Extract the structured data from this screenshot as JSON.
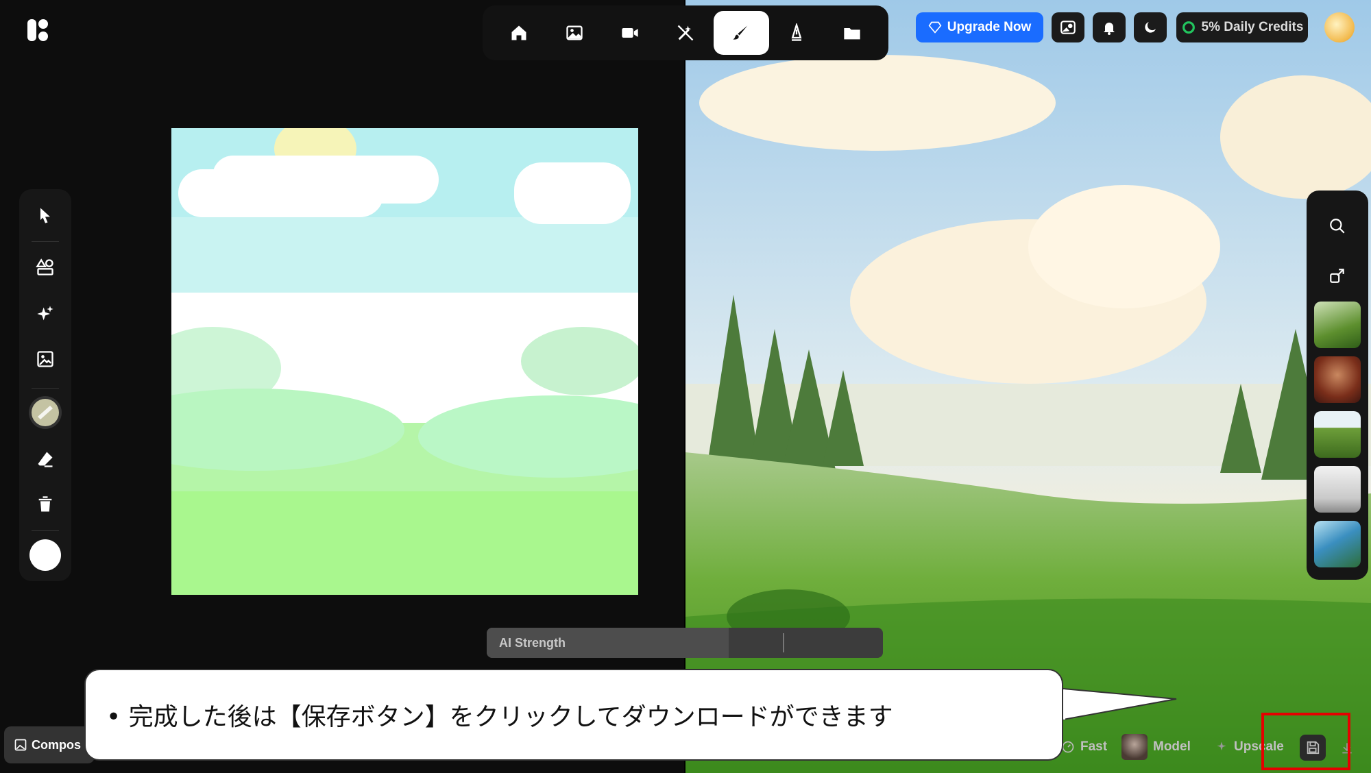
{
  "header": {
    "upgrade_label": "Upgrade Now",
    "credits_label": "5% Daily Credits"
  },
  "nav": {
    "items": [
      "home",
      "image",
      "video",
      "magic-wand",
      "brush",
      "pen",
      "folder"
    ],
    "active": "brush"
  },
  "canvas_panel": {
    "ai_strength_label": "AI Strength",
    "ai_strength_value": 0.61
  },
  "bottom_bar": {
    "compose_label": "Compos",
    "fast_label": "Fast",
    "model_label": "Model",
    "upscale_label": "Upscale"
  },
  "callout": {
    "text": "• 完成した後は【保存ボタン】をクリックしてダウンロードができます"
  },
  "colors": {
    "accent": "#1a6cff",
    "highlight": "#e60000",
    "credits_ring": "#22c55e"
  }
}
